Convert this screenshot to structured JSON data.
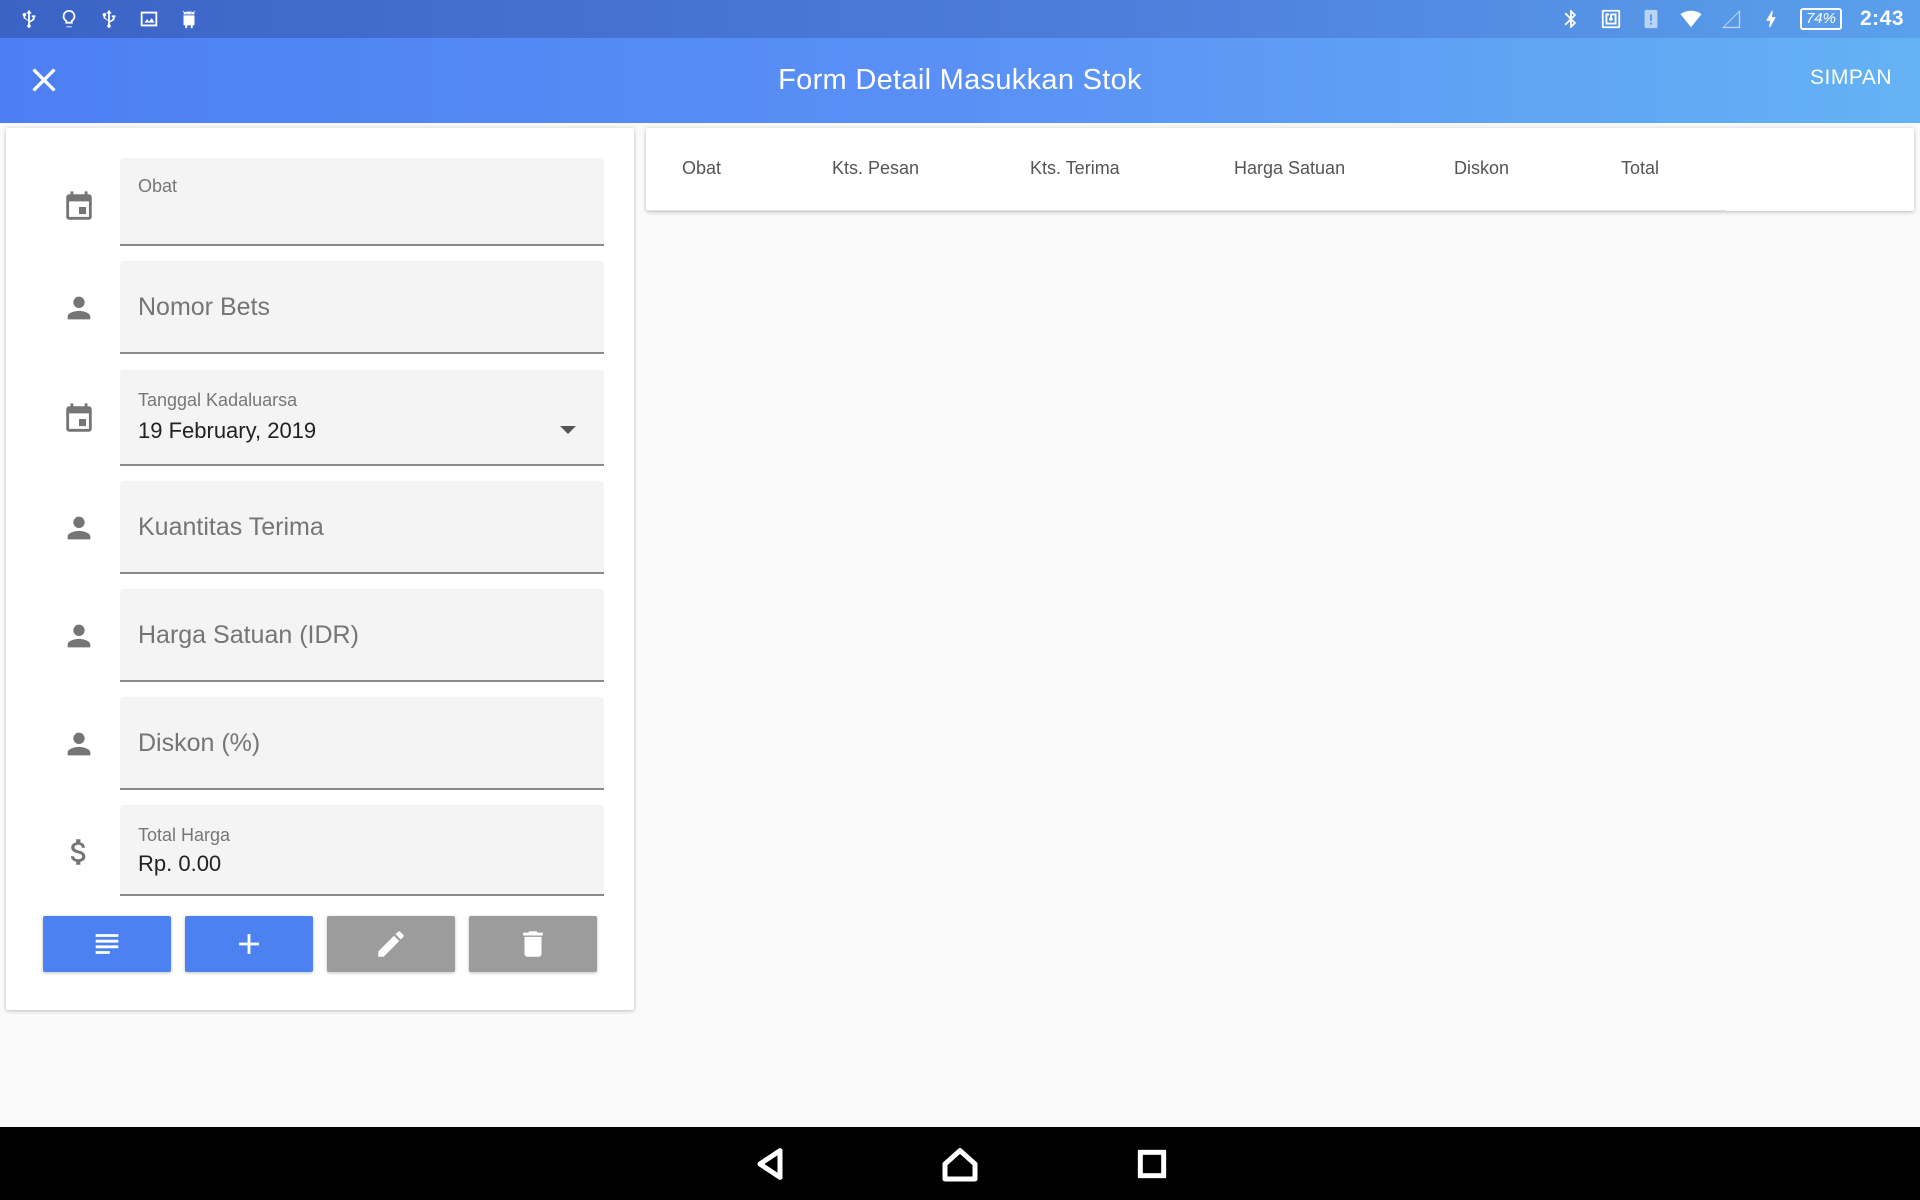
{
  "status_bar": {
    "left_icons": [
      "usb-icon",
      "lightbulb-icon",
      "usb-debug-icon",
      "image-icon",
      "android-icon"
    ],
    "right_icons": [
      "bluetooth-icon",
      "nfc-icon",
      "alert-icon",
      "wifi-icon",
      "signal-icon",
      "charging-icon"
    ],
    "battery": "74%",
    "time": "2:43"
  },
  "app_bar": {
    "title": "Form Detail Masukkan Stok",
    "save_label": "SIMPAN",
    "close_icon": "close-icon"
  },
  "form": {
    "obat": {
      "label": "Obat",
      "value": "",
      "icon": "calendar-icon"
    },
    "nomor_bets": {
      "placeholder": "Nomor Bets",
      "icon": "person-icon"
    },
    "tanggal_kadaluarsa": {
      "label": "Tanggal Kadaluarsa",
      "value": "19 February, 2019",
      "icon": "calendar-icon"
    },
    "kuantitas_terima": {
      "placeholder": "Kuantitas Terima",
      "icon": "person-icon"
    },
    "harga_satuan": {
      "placeholder": "Harga Satuan (IDR)",
      "icon": "person-icon"
    },
    "diskon": {
      "placeholder": "Diskon (%)",
      "icon": "person-icon"
    },
    "total_harga": {
      "label": "Total Harga",
      "value": "Rp. 0.00",
      "icon": "dollar-icon"
    }
  },
  "actions": [
    {
      "name": "list",
      "icon": "list-icon",
      "color": "#4d80f0"
    },
    {
      "name": "add",
      "icon": "plus-icon",
      "color": "#4d80f0"
    },
    {
      "name": "edit",
      "icon": "pencil-icon",
      "color": "#9c9c9c"
    },
    {
      "name": "delete",
      "icon": "trash-icon",
      "color": "#9c9c9c"
    }
  ],
  "table": {
    "columns": [
      "Obat",
      "Kts. Pesan",
      "Kts. Terima",
      "Harga Satuan",
      "Diskon",
      "Total"
    ],
    "rows": []
  },
  "colors": {
    "accent": "#4d80f0",
    "disabled": "#9c9c9c"
  }
}
